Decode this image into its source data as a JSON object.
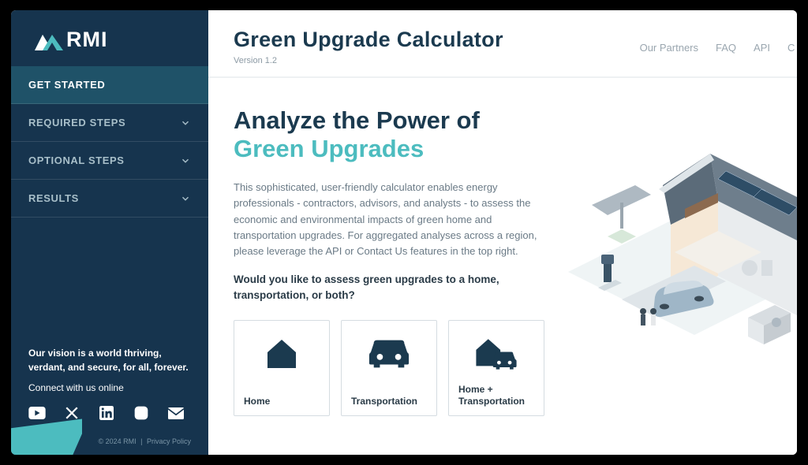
{
  "brand": {
    "logo_text": "RMI"
  },
  "sidebar": {
    "nav": [
      {
        "label": "GET STARTED",
        "expandable": false,
        "active": true
      },
      {
        "label": "REQUIRED STEPS",
        "expandable": true,
        "active": false
      },
      {
        "label": "OPTIONAL STEPS",
        "expandable": true,
        "active": false
      },
      {
        "label": "RESULTS",
        "expandable": true,
        "active": false
      }
    ],
    "vision": "Our vision is a world thriving, verdant, and secure, for all, forever.",
    "connect": "Connect with us online",
    "copyright": "© 2024 RMI",
    "privacy": "Privacy Policy"
  },
  "header": {
    "title": "Green Upgrade Calculator",
    "version": "Version 1.2",
    "links": [
      {
        "label": "Our Partners"
      },
      {
        "label": "FAQ"
      },
      {
        "label": "API"
      },
      {
        "label": "C"
      }
    ]
  },
  "hero": {
    "headline_part1": "Analyze the Power of",
    "headline_part2": "Green Upgrades",
    "description": "This sophisticated, user-friendly calculator enables energy professionals - contractors, advisors, and analysts - to assess the economic and environmental impacts of green home and transportation upgrades. For aggregated analyses across a region, please leverage the API or Contact Us features in the top right.",
    "prompt": "Would you like to assess green upgrades to a home, transportation, or both?"
  },
  "options": [
    {
      "label": "Home"
    },
    {
      "label": "Transportation"
    },
    {
      "label": "Home + Transportation"
    }
  ]
}
